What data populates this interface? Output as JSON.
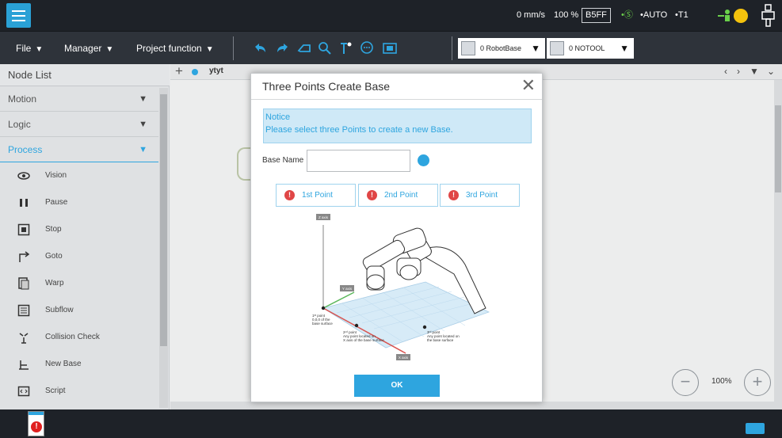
{
  "status": {
    "speed": "0 mm/s",
    "percent": "100 %",
    "mode_code": "B5FF",
    "mode_s": "•Ⓢ",
    "mode_auto": "•AUTO",
    "mode_t1": "•T1"
  },
  "menubar": {
    "file": "File",
    "manager": "Manager",
    "project_function": "Project function",
    "base_select": "0 RobotBase",
    "tool_select": "0 NOTOOL"
  },
  "node_list": {
    "title": "Node List",
    "categories": [
      {
        "label": "Motion"
      },
      {
        "label": "Logic"
      },
      {
        "label": "Process"
      }
    ],
    "items": [
      {
        "label": "Vision",
        "icon": "eye-icon"
      },
      {
        "label": "Pause",
        "icon": "pause-icon"
      },
      {
        "label": "Stop",
        "icon": "stop-icon"
      },
      {
        "label": "Goto",
        "icon": "goto-arrow-icon"
      },
      {
        "label": "Warp",
        "icon": "warp-icon"
      },
      {
        "label": "Subflow",
        "icon": "subflow-icon"
      },
      {
        "label": "Collision Check",
        "icon": "collision-icon"
      },
      {
        "label": "New Base",
        "icon": "new-base-icon"
      },
      {
        "label": "Script",
        "icon": "script-icon"
      }
    ]
  },
  "canvas": {
    "tab_name": "ytyt",
    "zoom": "100%"
  },
  "dialog": {
    "title": "Three Points Create Base",
    "notice_title": "Notice",
    "notice_text": "Please select three Points to create a new Base.",
    "base_name_label": "Base Name",
    "base_name_value": "",
    "point_buttons": [
      "1st Point",
      "2nd Point",
      "3rd Point"
    ],
    "ok": "OK",
    "illustration": {
      "z_axis": "Z axis",
      "y_axis": "Y axis",
      "x_axis": "X axis",
      "p1_title": "1ˢᵗ point",
      "p1_l1": "0,0,0 of the",
      "p1_l2": "base surface",
      "p2_title": "2ⁿᵈ point",
      "p2_l1": "Any point located on",
      "p2_l2": "X axis of the base surface",
      "p3_title": "3ʳᵈ point",
      "p3_l1": "Any point located on",
      "p3_l2": "the base surface"
    }
  },
  "colors": {
    "accent": "#2ea5df",
    "warning": "#e04646",
    "topbar": "#1e2228",
    "menubar": "#2e333a"
  }
}
